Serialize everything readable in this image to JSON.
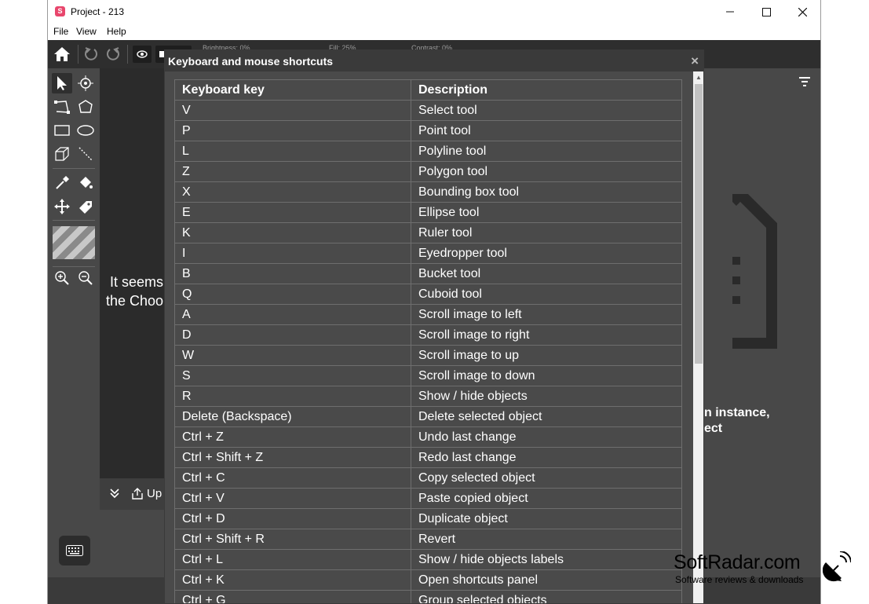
{
  "window": {
    "title": "Project - 213",
    "app_icon_letter": "S"
  },
  "menu": [
    {
      "label": "File"
    },
    {
      "label": "View"
    },
    {
      "label": "Help"
    }
  ],
  "toolbar": {
    "brightness": "Brightness: 0%",
    "fill": "Fill: 25%",
    "contrast": "Contrast: 0%"
  },
  "canvas": {
    "line1": "It seems",
    "line2": "the Choo"
  },
  "bottom": {
    "upload_label": "Up"
  },
  "right_panel": {
    "line1": "n instance,",
    "line2": "ect"
  },
  "modal": {
    "title": "Keyboard and mouse shortcuts",
    "close": "×",
    "headers": {
      "key": "Keyboard key",
      "description": "Description"
    },
    "rows": [
      {
        "key": "V",
        "description": "Select tool"
      },
      {
        "key": "P",
        "description": "Point tool"
      },
      {
        "key": "L",
        "description": "Polyline tool"
      },
      {
        "key": "Z",
        "description": "Polygon tool"
      },
      {
        "key": "X",
        "description": "Bounding box tool"
      },
      {
        "key": "E",
        "description": "Ellipse tool"
      },
      {
        "key": "K",
        "description": "Ruler tool"
      },
      {
        "key": "I",
        "description": "Eyedropper tool"
      },
      {
        "key": "B",
        "description": "Bucket tool"
      },
      {
        "key": "Q",
        "description": "Cuboid tool"
      },
      {
        "key": "A",
        "description": "Scroll image to left"
      },
      {
        "key": "D",
        "description": "Scroll image to right"
      },
      {
        "key": "W",
        "description": "Scroll image to up"
      },
      {
        "key": "S",
        "description": "Scroll image to down"
      },
      {
        "key": "R",
        "description": "Show / hide objects"
      },
      {
        "key": "Delete (Backspace)",
        "description": "Delete selected object"
      },
      {
        "key": "Ctrl + Z",
        "description": "Undo last change"
      },
      {
        "key": "Ctrl + Shift + Z",
        "description": "Redo last change"
      },
      {
        "key": "Ctrl + C",
        "description": "Copy selected object"
      },
      {
        "key": "Ctrl + V",
        "description": "Paste copied object"
      },
      {
        "key": "Ctrl + D",
        "description": "Duplicate object"
      },
      {
        "key": "Ctrl + Shift + R",
        "description": "Revert"
      },
      {
        "key": "Ctrl + L",
        "description": "Show / hide objects labels"
      },
      {
        "key": "Ctrl + K",
        "description": "Open shortcuts panel"
      },
      {
        "key": "Ctrl + G",
        "description": "Group selected objects"
      }
    ]
  },
  "watermark": {
    "main": "SoftRadar.com",
    "sub": "Software reviews & downloads"
  },
  "colors": {
    "app_icon": "#e8466c",
    "toolbar_bg": "#2e2e2e",
    "panel_bg": "#484848",
    "modal_bg": "#4a4a4a",
    "modal_header_bg": "#3a3a3a"
  },
  "icons": [
    "home-icon",
    "undo-icon",
    "redo-icon",
    "eye-icon",
    "tag-icon",
    "select-arrow-icon",
    "point-icon",
    "polyline-icon",
    "polygon-icon",
    "rectangle-icon",
    "ellipse-icon",
    "cuboid-icon",
    "ruler-icon",
    "eyedropper-icon",
    "bucket-icon",
    "move-icon",
    "label-icon",
    "zoom-in-icon",
    "zoom-out-icon",
    "keyboard-icon",
    "filter-icon",
    "chevrons-down-icon",
    "upload-icon",
    "close-icon"
  ]
}
